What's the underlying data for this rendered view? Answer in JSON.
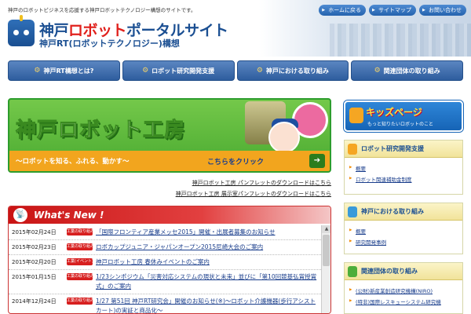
{
  "header": {
    "tagline": "神戸のロボットビジネスを応援する神戸ロボットテクノロジー構想のサイトです。",
    "logo_pre": "神戸",
    "logo_red": "ロボット",
    "logo_post": "ポータルサイト",
    "logo_sub": "神戸RT(ロボットテクノロジー)構想",
    "links": [
      "ホームに戻る",
      "サイトマップ",
      "お問い合わせ"
    ]
  },
  "nav": {
    "items": [
      "神戸RT構想とは?",
      "ロボット研究開発支援",
      "神戸における取り組み",
      "関連団体の取り組み"
    ]
  },
  "banner": {
    "title": "神戸ロボット工房",
    "tagline": "～ロボットを知る、ふれる、動かす～",
    "click": "こちらをクリック",
    "arrow": "➔"
  },
  "pdf_links": [
    "神戸ロボット工房 パンフレットのダウンロードはこちら",
    "神戸ロボット工房 展示室パンフレットのダウンロードはこちら"
  ],
  "news": {
    "title": "What's New !",
    "items": [
      {
        "date": "2015年02月24日",
        "badge": "工業の取り組み",
        "text": "「国際フロンティア産業メッセ2015」開催・出展者募集のお知らせ"
      },
      {
        "date": "2015年02月23日",
        "badge": "工業の取り組み",
        "text": "ロボカップジュニア・ジャパンオープン2015尼崎大会のご案内"
      },
      {
        "date": "2015年02月20日",
        "badge": "工業(イベント)",
        "text": "神戸ロボット工房 春休みイベントのご案内"
      },
      {
        "date": "2015年01月15日",
        "badge": "工業の取り組み",
        "text": "1/23シンポジウム「災害対応システムの現状と未来」並びに「第10回競基弘賞授賞式」のご案内"
      },
      {
        "date": "2014年12月24日",
        "badge": "工業の取り組み",
        "text": "1/27 第51回 神戸RT研究会」開催のお知らせ(※)～ロボット介護機器(歩行アシストカート)の実証と商品化～"
      }
    ]
  },
  "kids": {
    "title": "キッズページ",
    "sub": "もっと知りたいロボットのこと"
  },
  "side": [
    {
      "title": "ロボット研究開発支援",
      "bot_color": "#f5a623",
      "items": [
        "概要",
        "ロボット関連補助金制度"
      ]
    },
    {
      "title": "神戸における取り組み",
      "bot_color": "#3a9ad9",
      "items": [
        "概要",
        "研究開発事例"
      ]
    },
    {
      "title": "関連団体の取り組み",
      "bot_color": "#4cae3a",
      "items": [
        "(公財)新産業創造研究機構(NIRO)",
        "(特非)国際レスキューシステム研究機"
      ]
    }
  ]
}
